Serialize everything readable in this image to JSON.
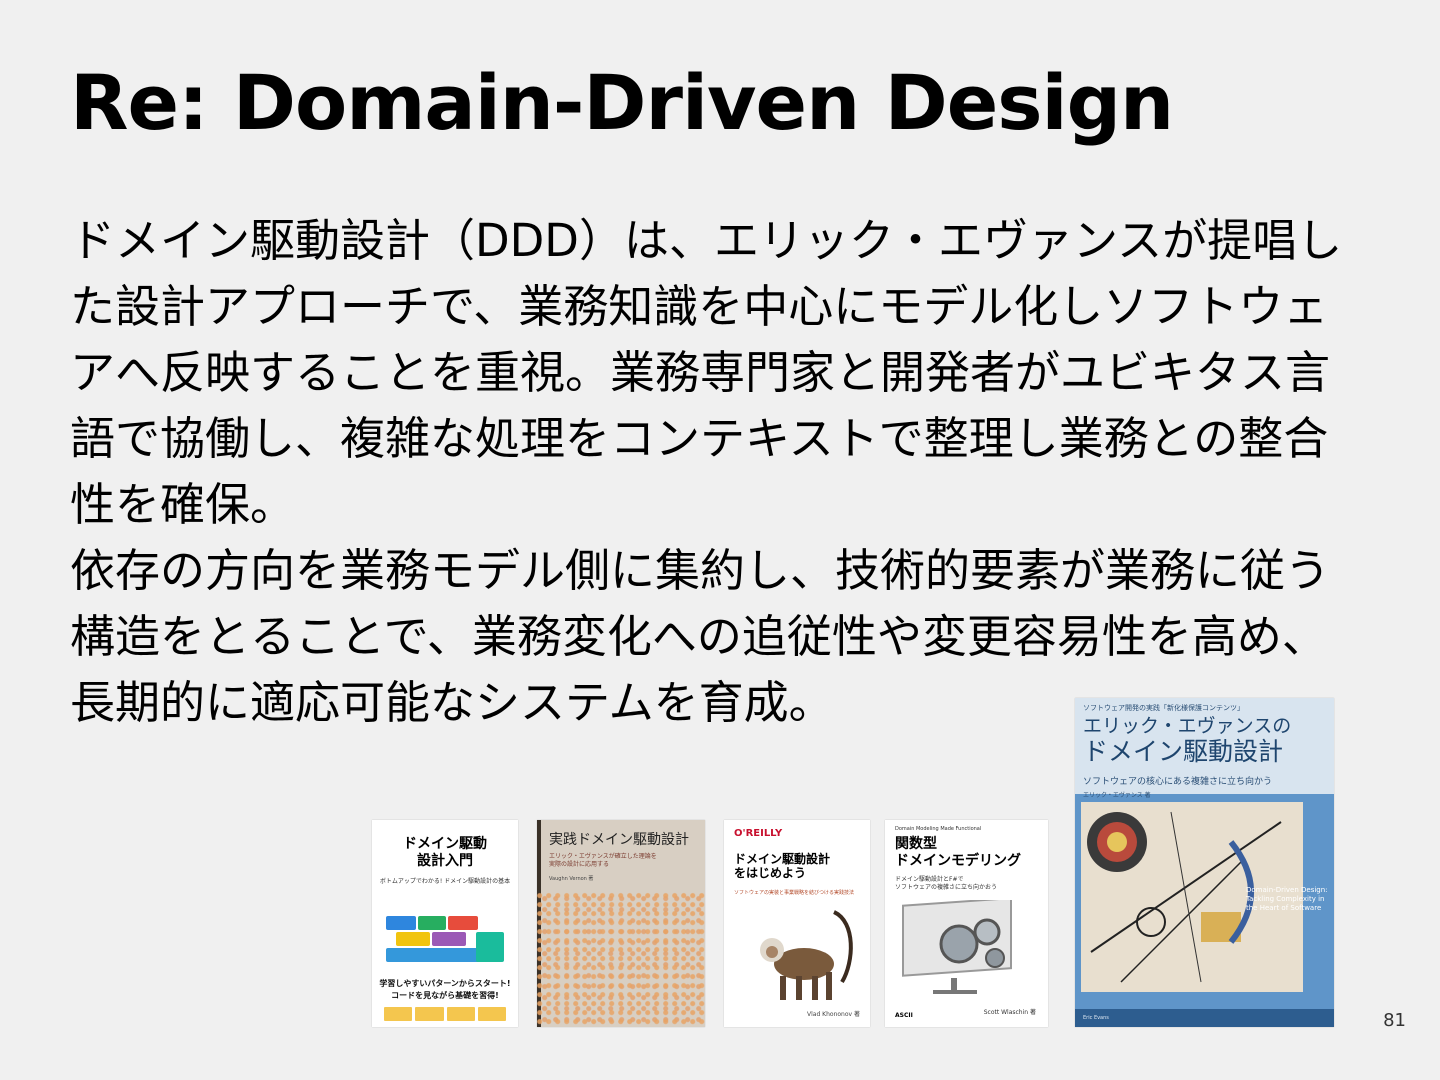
{
  "slide": {
    "title": "Re: Domain-Driven Design",
    "paragraph_1": "ドメイン駆動設計（DDD）は、エリック・エヴァンスが提唱した設計アプローチで、業務知識を中心にモデル化しソフトウェアへ反映することを重視。業務専門家と開発者がユビキタス言語で協働し、複雑な処理をコンテキストで整理し業務との整合性を確保。",
    "paragraph_2": "依存の方向を業務モデル側に集約し、技術的要素が業務に従う構造をとることで、業務変化への追従性や変更容易性を高め、長期的に適応可能なシステムを育成。",
    "page_number": "81"
  },
  "books": [
    {
      "title": "ドメイン駆動\n設計入門",
      "subtitle": "ボトムアップでわかる! ドメイン駆動設計の基本",
      "tagline": "学習しやすいパターンからスタート!\nコードを見ながら基礎を習得!"
    },
    {
      "title": "実践ドメイン駆動設計",
      "subtitle": "エリック・エヴァンスが確立した理論を\n実際の設計に応用する",
      "author": "Vaughn Vernon 著"
    },
    {
      "publisher": "O'REILLY",
      "title": "ドメイン駆動設計\nをはじめよう",
      "subtitle": "ソフトウェアの実装と事業戦略を結びつける実践技法",
      "author": "Vlad Khononov 著"
    },
    {
      "kicker": "Domain Modeling Made Functional",
      "title": "関数型\nドメインモデリング",
      "subtitle": "ドメイン駆動設計とF#で\nソフトウェアの複雑さに立ち向かおう",
      "author": "Scott Wlaschin 著",
      "publisher": "ASCII"
    },
    {
      "kicker": "ソフトウェア開発の実践「新化様保護コンテンツ」",
      "title_line1": "エリック・エヴァンスの",
      "title_line2": "ドメイン駆動設計",
      "subtitle": "ソフトウェアの核心にある複雑さに立ち向かう",
      "author": "エリック・エヴァンス 著",
      "english_title": "Domain-Driven Design: Tackling Complexity in the Heart of Software",
      "english_author": "Eric Evans"
    }
  ],
  "colors": {
    "background": "#f0f0f0",
    "text": "#000000",
    "cover5_blue": "#5f95c9"
  }
}
